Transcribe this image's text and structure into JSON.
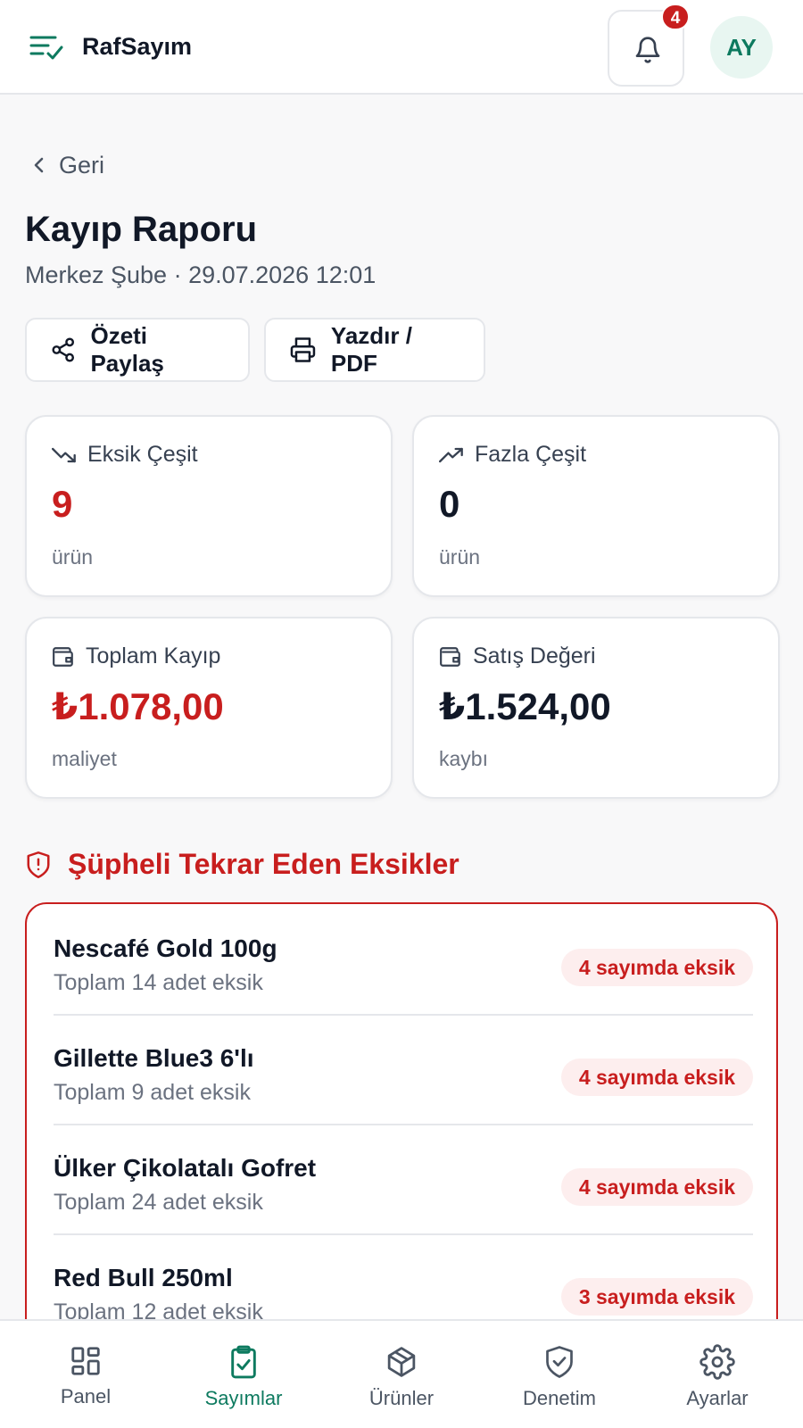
{
  "header": {
    "app_name": "RafSayım",
    "notifications_count": "4",
    "avatar_initials": "AY"
  },
  "nav_back": {
    "label": "Geri"
  },
  "page": {
    "title": "Kayıp Raporu",
    "subtitle": "Merkez Şube · 29.07.2026 12:01"
  },
  "actions": {
    "share_label": "Özeti Paylaş",
    "print_label": "Yazdır / PDF"
  },
  "stats": [
    {
      "label": "Eksik Çeşit",
      "value": "9",
      "unit": "ürün",
      "icon": "trending-down-icon"
    },
    {
      "label": "Fazla Çeşit",
      "value": "0",
      "unit": "ürün",
      "icon": "trending-up-icon"
    },
    {
      "label": "Toplam Kayıp",
      "value": "₺1.078,00",
      "unit": "maliyet",
      "icon": "wallet-icon"
    },
    {
      "label": "Satış Değeri",
      "value": "₺1.524,00",
      "unit": "kaybı",
      "icon": "wallet-icon"
    }
  ],
  "suspicious": {
    "title": "Şüpheli Tekrar Eden Eksikler",
    "items": [
      {
        "name": "Nescafé Gold 100g",
        "detail": "Toplam 14 adet eksik",
        "badge": "4 sayımda eksik"
      },
      {
        "name": "Gillette Blue3 6'lı",
        "detail": "Toplam 9 adet eksik",
        "badge": "4 sayımda eksik"
      },
      {
        "name": "Ülker Çikolatalı Gofret",
        "detail": "Toplam 24 adet eksik",
        "badge": "4 sayımda eksik"
      },
      {
        "name": "Red Bull 250ml",
        "detail": "Toplam 12 adet eksik",
        "badge": "3 sayımda eksik"
      }
    ]
  },
  "bottom_nav": [
    {
      "label": "Panel",
      "icon": "grid-icon",
      "active": false
    },
    {
      "label": "Sayımlar",
      "icon": "clipboard-check-icon",
      "active": true
    },
    {
      "label": "Ürünler",
      "icon": "box-icon",
      "active": false
    },
    {
      "label": "Denetim",
      "icon": "shield-check-icon",
      "active": false
    },
    {
      "label": "Ayarlar",
      "icon": "gear-icon",
      "active": false
    }
  ],
  "colors": {
    "accent": "#0d7a5f",
    "danger": "#c81e1e",
    "danger_bg": "#fdeeee",
    "text": "#111827",
    "muted": "#6b7280"
  }
}
